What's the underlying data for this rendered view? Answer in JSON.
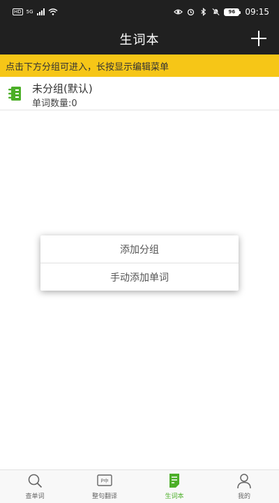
{
  "status_bar": {
    "hd": "HD",
    "network": "5G",
    "battery": "96",
    "time": "09:15"
  },
  "header": {
    "title": "生词本",
    "add_icon": "plus-icon"
  },
  "hint": "点击下方分组可进入，长按显示编辑菜单",
  "groups": [
    {
      "name": "未分组(默认)",
      "count_label": "单词数量:0",
      "icon": "notebook-icon"
    }
  ],
  "popup_menu": {
    "items": [
      "添加分组",
      "手动添加单词"
    ]
  },
  "bottom_nav": {
    "items": [
      {
        "label": "查单词",
        "icon": "search-icon",
        "active": false
      },
      {
        "label": "整句翻译",
        "icon": "translate-icon",
        "active": false
      },
      {
        "label": "生词本",
        "icon": "vocabulary-book-icon",
        "active": true
      },
      {
        "label": "我的",
        "icon": "profile-icon",
        "active": false
      }
    ]
  },
  "colors": {
    "bar_background": "#202020",
    "hint_background": "#f6c617",
    "accent_green": "#4caf28"
  }
}
